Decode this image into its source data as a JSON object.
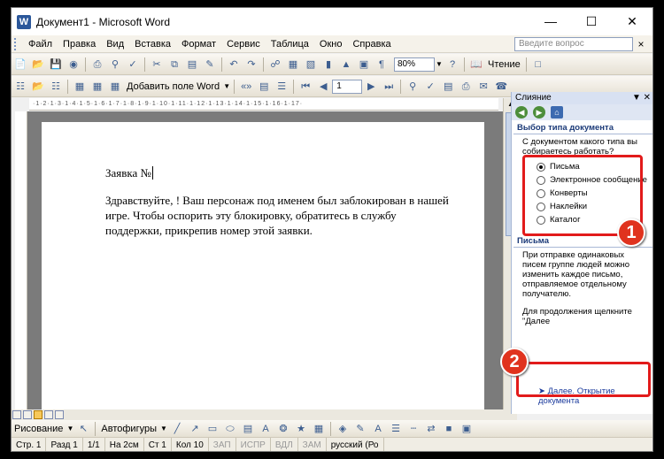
{
  "window": {
    "title": "Документ1 - Microsoft Word"
  },
  "menu": [
    "Файл",
    "Правка",
    "Вид",
    "Вставка",
    "Формат",
    "Сервис",
    "Таблица",
    "Окно",
    "Справка"
  ],
  "help_box": {
    "placeholder": "Введите вопрос"
  },
  "toolbar1": {
    "zoom": "80%",
    "reading_label": "Чтение"
  },
  "toolbar2": {
    "add_field_label": "Добавить поле Word",
    "page_number": "1"
  },
  "document": {
    "title_line": "Заявка №",
    "body": "Здравствуйте,   ! Ваш персонаж под именем  был заблокирован в нашей игре. Чтобы оспорить эту блокировку, обратитесь в службу поддержки, прикрепив номер этой заявки."
  },
  "task_pane": {
    "header": "Слияние",
    "section_type": "Выбор типа документа",
    "question": "С документом какого типа вы собираетесь работать?",
    "options": [
      "Письма",
      "Электронное сообщение",
      "Конверты",
      "Наклейки",
      "Каталог"
    ],
    "selected_option": "Письма",
    "section_letters": "Письма",
    "description": "При отправке одинаковых писем группе людей можно изменить каждое письмо, отправляемое отдельному получателю.",
    "continue_hint": "Для продолжения щелкните \"Далее",
    "next_link": "Далее. Открытие документа"
  },
  "annotations": {
    "badge1": "1",
    "badge2": "2",
    "color": "#e21b1b"
  },
  "drawing_toolbar": {
    "draw_label": "Рисование",
    "autoshapes_label": "Автофигуры"
  },
  "status_bar": {
    "page": "Стр. 1",
    "section": "Разд 1",
    "pages": "1/1",
    "position": "На 2см",
    "line": "Ст 1",
    "column": "Кол 10",
    "rec": "ЗАП",
    "trk": "ИСПР",
    "ext": "ВДЛ",
    "ovr": "ЗАМ",
    "language": "русский (Ро"
  }
}
